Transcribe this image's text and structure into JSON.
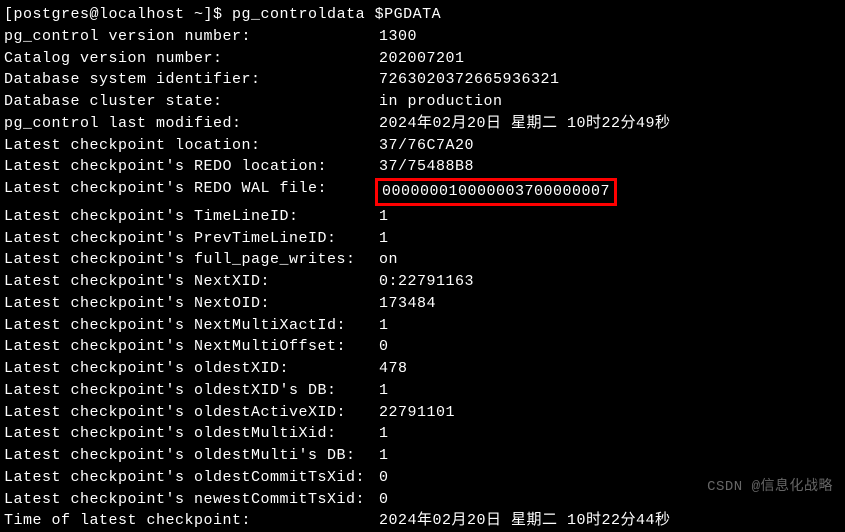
{
  "prompt": {
    "user_host": "[postgres@localhost ~]$ ",
    "command": "pg_controldata $PGDATA"
  },
  "rows": [
    {
      "label": "pg_control version number:            ",
      "value": "1300",
      "highlighted": false
    },
    {
      "label": "Catalog version number:               ",
      "value": "202007201",
      "highlighted": false
    },
    {
      "label": "Database system identifier:           ",
      "value": "7263020372665936321",
      "highlighted": false
    },
    {
      "label": "Database cluster state:               ",
      "value": "in production",
      "highlighted": false
    },
    {
      "label": "pg_control last modified:             ",
      "value": "2024年02月20日 星期二 10时22分49秒",
      "highlighted": false
    },
    {
      "label": "Latest checkpoint location:           ",
      "value": "37/76C7A20",
      "highlighted": false
    },
    {
      "label": "Latest checkpoint's REDO location:    ",
      "value": "37/75488B8",
      "highlighted": false
    },
    {
      "label": "Latest checkpoint's REDO WAL file:    ",
      "value": "000000010000003700000007",
      "highlighted": true
    },
    {
      "label": "Latest checkpoint's TimeLineID:       ",
      "value": "1",
      "highlighted": false
    },
    {
      "label": "Latest checkpoint's PrevTimeLineID:   ",
      "value": "1",
      "highlighted": false
    },
    {
      "label": "Latest checkpoint's full_page_writes: ",
      "value": "on",
      "highlighted": false
    },
    {
      "label": "Latest checkpoint's NextXID:          ",
      "value": "0:22791163",
      "highlighted": false
    },
    {
      "label": "Latest checkpoint's NextOID:          ",
      "value": "173484",
      "highlighted": false
    },
    {
      "label": "Latest checkpoint's NextMultiXactId:  ",
      "value": "1",
      "highlighted": false
    },
    {
      "label": "Latest checkpoint's NextMultiOffset:  ",
      "value": "0",
      "highlighted": false
    },
    {
      "label": "Latest checkpoint's oldestXID:        ",
      "value": "478",
      "highlighted": false
    },
    {
      "label": "Latest checkpoint's oldestXID's DB:   ",
      "value": "1",
      "highlighted": false
    },
    {
      "label": "Latest checkpoint's oldestActiveXID:  ",
      "value": "22791101",
      "highlighted": false
    },
    {
      "label": "Latest checkpoint's oldestMultiXid:   ",
      "value": "1",
      "highlighted": false
    },
    {
      "label": "Latest checkpoint's oldestMulti's DB: ",
      "value": "1",
      "highlighted": false
    },
    {
      "label": "Latest checkpoint's oldestCommitTsXid:",
      "value": "0",
      "highlighted": false
    },
    {
      "label": "Latest checkpoint's newestCommitTsXid:",
      "value": "0",
      "highlighted": false
    },
    {
      "label": "Time of latest checkpoint:            ",
      "value": "2024年02月20日 星期二 10时22分44秒",
      "highlighted": false
    }
  ],
  "watermark": "CSDN @信息化战略"
}
